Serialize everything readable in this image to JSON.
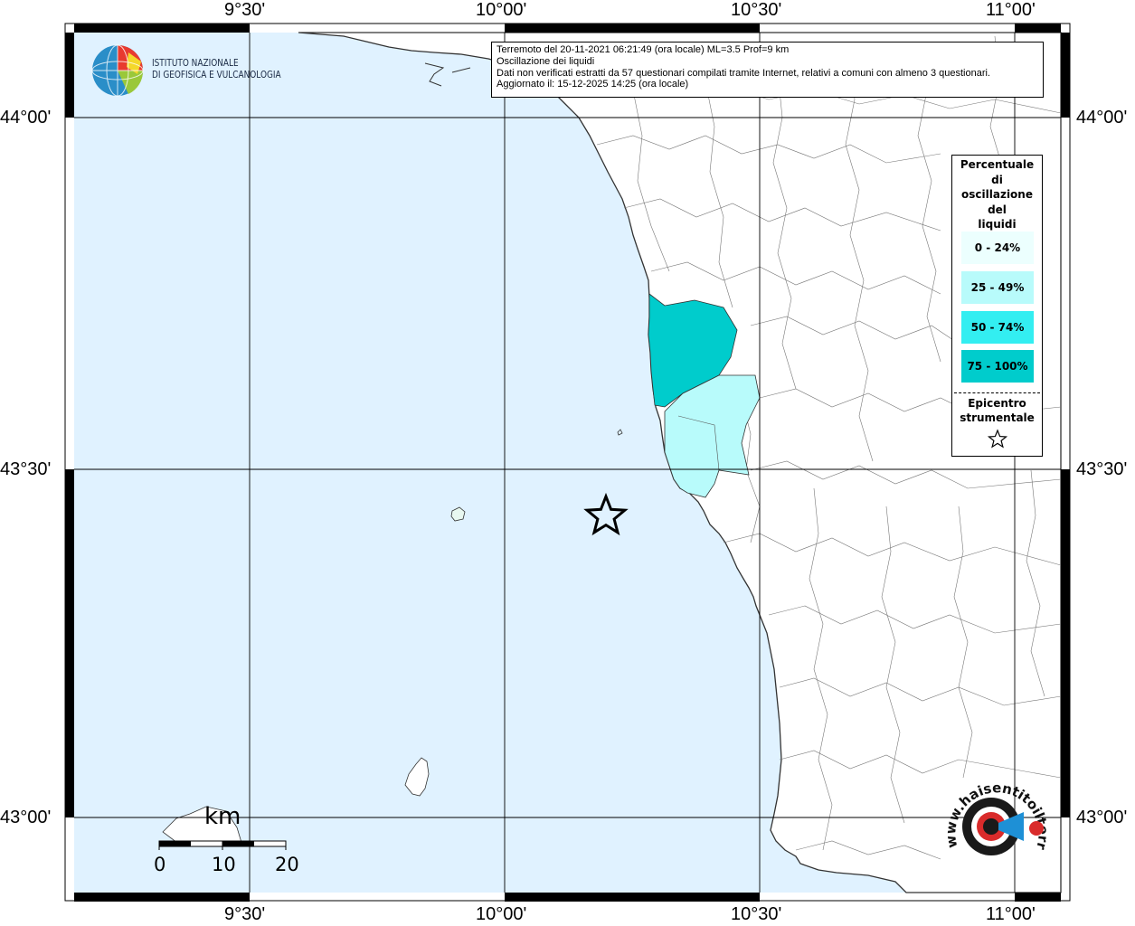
{
  "info": {
    "line1": "Terremoto del 20-11-2021 06:21:49 (ora locale) ML=3.5 Prof=9 km",
    "line2": "Oscillazione dei liquidi",
    "line3": "Dati non verificati estratti da 57 questionari compilati tramite Internet, relativi a comuni con almeno 3 questionari.",
    "line4": "Aggiornato il: 15-12-2025 14:25 (ora locale)"
  },
  "ticks": {
    "lon": [
      "9°30'",
      "10°00'",
      "10°30'",
      "11°00'"
    ],
    "lat": [
      "44°00'",
      "43°30'",
      "43°00'"
    ]
  },
  "institute": {
    "line1": "ISTITUTO NAZIONALE",
    "line2": "DI GEOFISICA E VULCANOLOGIA"
  },
  "legend": {
    "title": [
      "Percentuale",
      "di",
      "oscillazione",
      "del",
      "liquidi"
    ],
    "classes": [
      {
        "label": "0 - 24%",
        "color": "#ecfffe"
      },
      {
        "label": "25 - 49%",
        "color": "#b8fbfb"
      },
      {
        "label": "50 - 74%",
        "color": "#33eef1"
      },
      {
        "label": "75 - 100%",
        "color": "#00cccc"
      }
    ],
    "epicenter_label": [
      "Epicentro",
      "strumentale"
    ]
  },
  "scale": {
    "unit": "km",
    "labels": [
      "0",
      "10",
      "20"
    ]
  },
  "colors": {
    "sea": "#e0f2ff",
    "land": "#ffffff",
    "class_75_100": "#00cccc",
    "class_25_49": "#b8fbfb"
  },
  "logo_text": "www.haisentitoilterremoto.it"
}
